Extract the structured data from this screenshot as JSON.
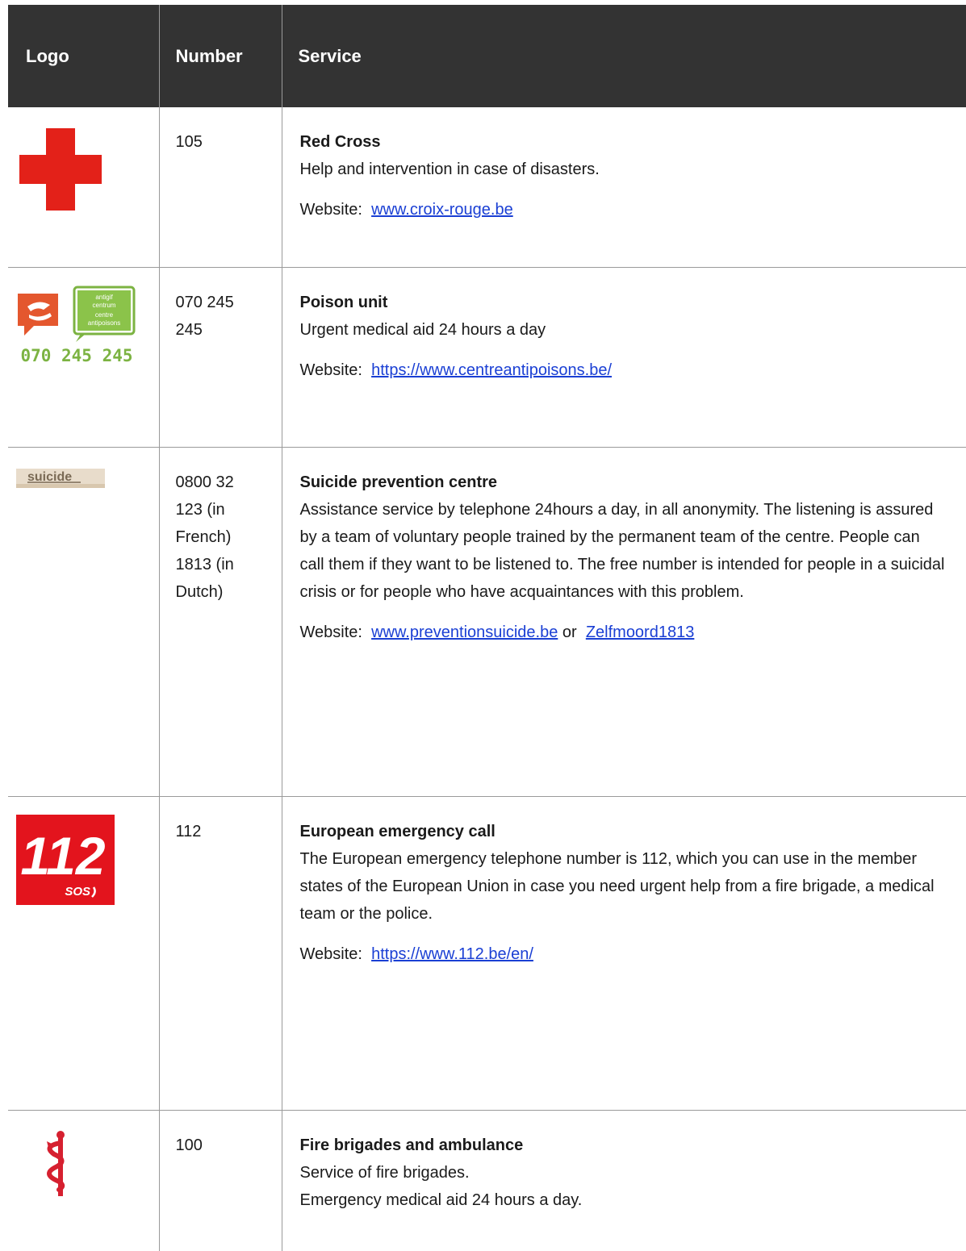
{
  "headers": {
    "logo": "Logo",
    "number": "Number",
    "service": "Service"
  },
  "rows": [
    {
      "logo_icon": "red-cross-logo",
      "number": "105",
      "title": "Red Cross",
      "desc": [
        "Help and intervention in case of disasters."
      ],
      "website_label": "Website:",
      "links": [
        "www.croix-rouge.be"
      ]
    },
    {
      "logo_icon": "poison-centre-logo",
      "logo_text": "070 245 245",
      "logo_bubble_lines": [
        "antigif",
        "centrum",
        "centre",
        "antipoisons"
      ],
      "number": "070 245 245",
      "title": "Poison unit",
      "desc": [
        "Urgent medical aid 24 hours a day"
      ],
      "website_label": "Website:",
      "links": [
        "https://www.centreantipoisons.be/"
      ]
    },
    {
      "logo_icon": "suicide-prevention-logo",
      "logo_text": "suicide",
      "number": "0800 32 123 (in French) 1813 (in Dutch)",
      "title": "Suicide prevention centre",
      "desc": [
        "Assistance service by telephone 24hours a day, in all anonymity. The listening is assured by a team of voluntary people trained by the permanent team of the centre. People can call them if they want to be listened to. The free number is intended for people in a suicidal crisis or for people who have acquaintances with this problem."
      ],
      "website_label": "Website:",
      "links": [
        "www.preventionsuicide.be",
        "Zelfmoord1813"
      ],
      "link_joiner": "or"
    },
    {
      "logo_icon": "112-sos-logo",
      "logo_text": "112",
      "logo_sub": "SOS",
      "number": "112",
      "title": "European emergency call",
      "desc": [
        "The European emergency telephone number is 112, which you can use in the member states of the European Union in case you need urgent help from a fire brigade, a medical team or the police."
      ],
      "website_label": "Website:",
      "links": [
        "https://www.112.be/en/"
      ]
    },
    {
      "logo_icon": "star-of-life-logo",
      "number": "100",
      "title": "Fire brigades and ambulance",
      "desc": [
        "Service of fire brigades.",
        "Emergency medical aid 24 hours a day."
      ]
    }
  ],
  "colors": {
    "header_bg": "#333333",
    "link": "#1a3fd4",
    "red_cross": "#e32119",
    "poison_orange": "#e4572e",
    "poison_green": "#7cb342"
  }
}
